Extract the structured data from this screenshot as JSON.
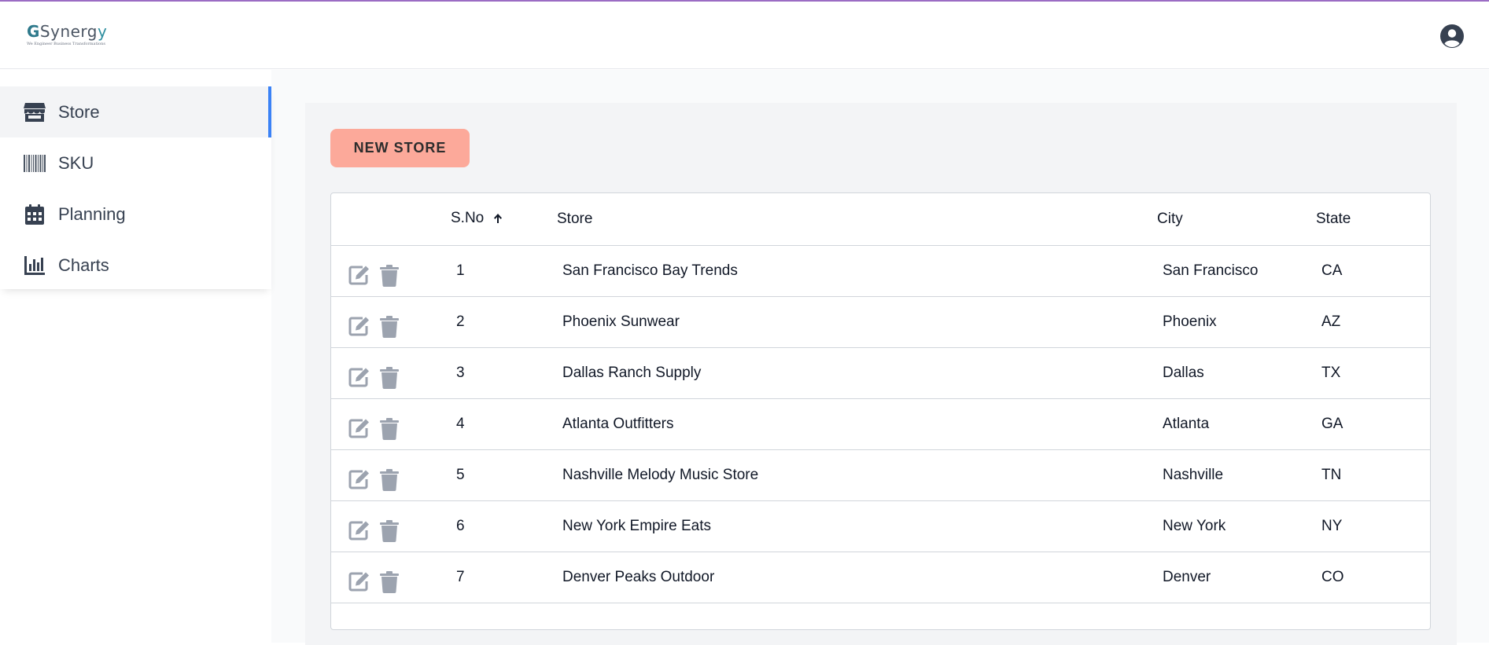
{
  "app": {
    "logo_text_g": "G",
    "logo_text_rest": "Synerg",
    "logo_text_y": "y",
    "logo_tagline": "We Engineer Business Transformations"
  },
  "icons": {
    "user": "user-circle-icon",
    "store": "store-icon",
    "sku": "barcode-icon",
    "planning": "calendar-icon",
    "charts": "bar-chart-icon",
    "edit": "edit-icon",
    "delete": "trash-icon",
    "sort": "arrow-up-icon"
  },
  "colors": {
    "accent_bar": "#9b6cc4",
    "active_indicator": "#3b82f6",
    "new_store_button": "#fca99a",
    "action_icons": "#9ca3af"
  },
  "sidebar": {
    "items": [
      {
        "label": "Store",
        "active": true
      },
      {
        "label": "SKU",
        "active": false
      },
      {
        "label": "Planning",
        "active": false
      },
      {
        "label": "Charts",
        "active": false
      }
    ]
  },
  "toolbar": {
    "new_store_label": "NEW STORE"
  },
  "table": {
    "columns": [
      "",
      "S.No",
      "Store",
      "City",
      "State"
    ],
    "sort_column": "S.No",
    "sort_direction": "ascending",
    "rows": [
      {
        "sno": "1",
        "store": "San Francisco Bay Trends",
        "city": "San Francisco",
        "state": "CA"
      },
      {
        "sno": "2",
        "store": "Phoenix Sunwear",
        "city": "Phoenix",
        "state": "AZ"
      },
      {
        "sno": "3",
        "store": "Dallas Ranch Supply",
        "city": "Dallas",
        "state": "TX"
      },
      {
        "sno": "4",
        "store": "Atlanta Outfitters",
        "city": "Atlanta",
        "state": "GA"
      },
      {
        "sno": "5",
        "store": "Nashville Melody Music Store",
        "city": "Nashville",
        "state": "TN"
      },
      {
        "sno": "6",
        "store": "New York Empire Eats",
        "city": "New York",
        "state": "NY"
      },
      {
        "sno": "7",
        "store": "Denver Peaks Outdoor",
        "city": "Denver",
        "state": "CO"
      }
    ]
  }
}
